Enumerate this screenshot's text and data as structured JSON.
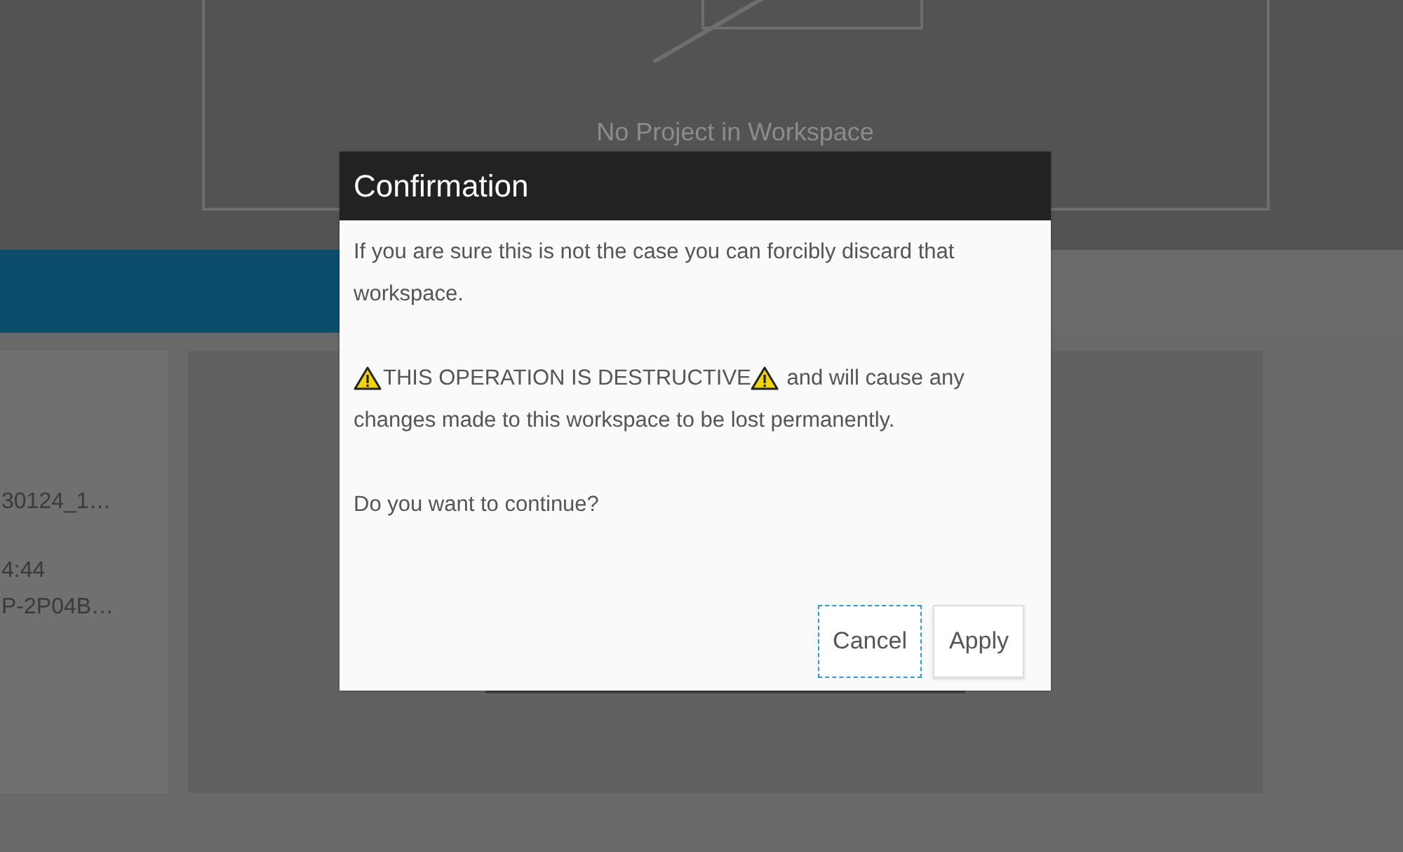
{
  "background": {
    "empty_state": {
      "message": "No Project in Workspace"
    },
    "details": [
      "30124_1…",
      "4:44",
      "P-2P04B…"
    ]
  },
  "dialog": {
    "title": "Confirmation",
    "paragraphs": [
      {
        "kind": "text",
        "text": "If you are sure this is not the case you can forcibly discard that workspace."
      },
      {
        "kind": "warning",
        "warning": "THIS OPERATION IS DESTRUCTIVE",
        "text": "and will cause any changes made to this workspace to be lost permanently."
      },
      {
        "kind": "text",
        "text": "Do you want to continue?"
      }
    ],
    "buttons": [
      {
        "label": "Cancel",
        "focused": true
      },
      {
        "label": "Apply",
        "focused": false
      }
    ]
  }
}
